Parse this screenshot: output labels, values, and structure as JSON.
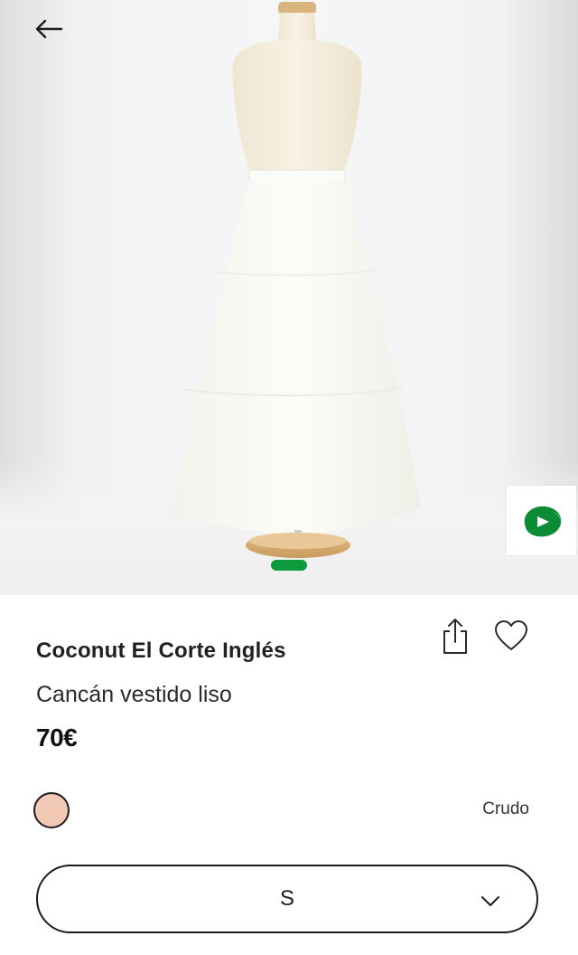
{
  "product": {
    "brand": "Coconut El Corte Inglés",
    "name": "Cancán vestido liso",
    "price": "70€"
  },
  "gallery": {
    "slides_count": 1,
    "current_slide": 1
  },
  "color": {
    "label": "Crudo",
    "swatch_hex": "#f1c9b4"
  },
  "size_selector": {
    "value": "S"
  },
  "icons": {
    "back": "arrow-left-icon",
    "share": "share-icon",
    "favorite": "heart-icon",
    "video": "play-video-icon",
    "dropdown": "chevron-down-icon"
  },
  "colors": {
    "accent_green": "#0e9b3d",
    "text": "#1f1f1f"
  }
}
